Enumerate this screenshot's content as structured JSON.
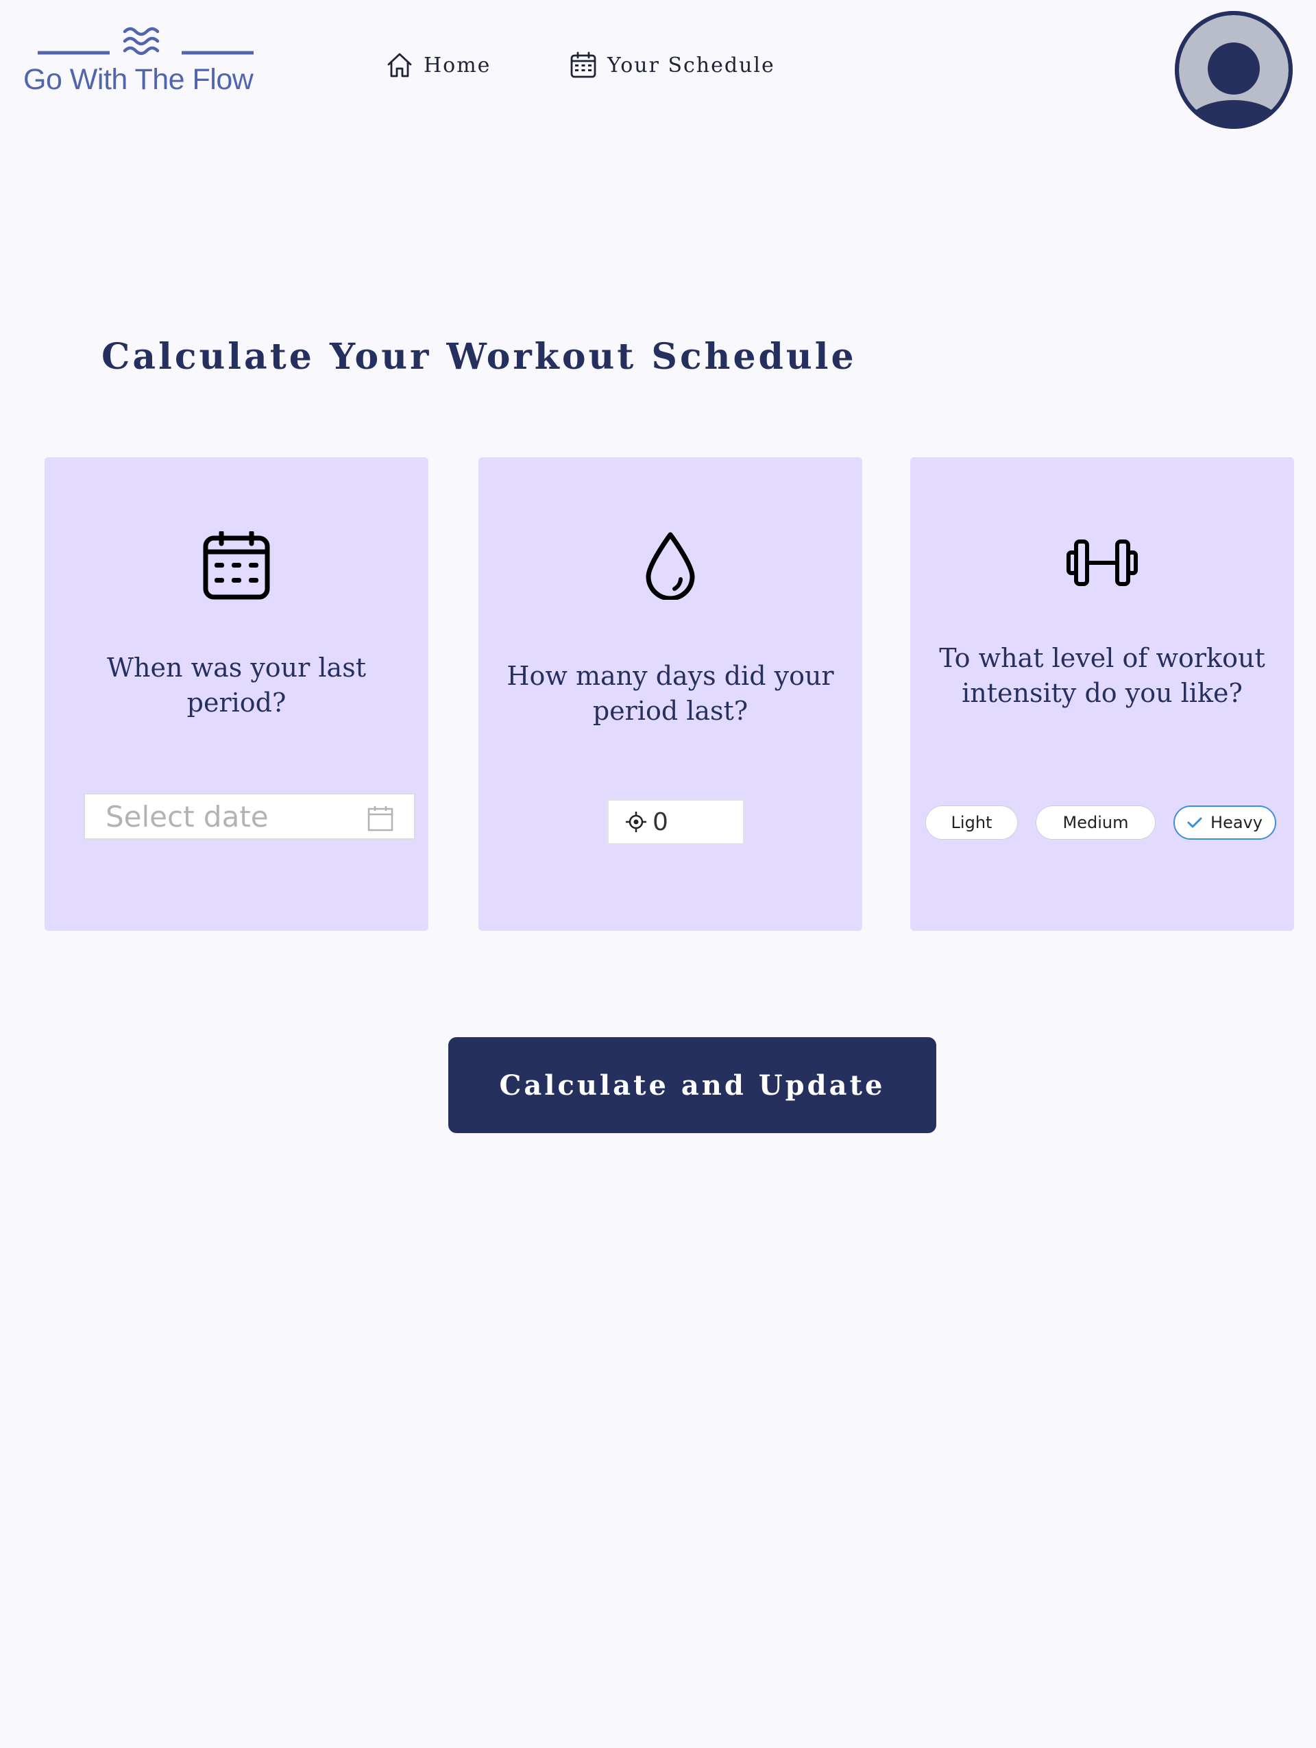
{
  "header": {
    "logo_text": "Go With The Flow",
    "nav": {
      "home_label": "Home",
      "schedule_label": "Your Schedule"
    }
  },
  "main": {
    "title": "Calculate Your Workout Schedule",
    "cards": {
      "last_period": {
        "question": "When was your last period?",
        "date_placeholder": "Select date"
      },
      "period_length": {
        "question": "How many days did your period last?",
        "value": "0"
      },
      "intensity": {
        "question": "To what level of workout intensity do you like?",
        "options": [
          "Light",
          "Medium",
          "Heavy"
        ],
        "selected": "Heavy"
      }
    },
    "calculate_button": "Calculate and Update"
  },
  "icons": {
    "logo": "waves-icon",
    "home": "home-icon",
    "schedule": "calendar-icon",
    "avatar": "user-avatar-icon",
    "card_date": "calendar-icon",
    "card_days": "droplet-icon",
    "card_intensity": "dumbbell-icon",
    "date_field": "calendar-outline-icon",
    "num_field": "crosshair-icon",
    "selected": "check-icon"
  },
  "colors": {
    "primary": "#26305f",
    "logo": "#5165ad",
    "card_background": "#e3daff",
    "page_background": "#f9f9fd",
    "selected_border": "#3b8fdb"
  }
}
